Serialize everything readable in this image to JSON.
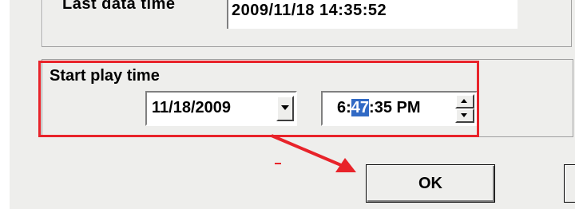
{
  "last_data": {
    "label": "Last data time",
    "value": "2009/11/18 14:35:52"
  },
  "start_play": {
    "label": "Start play time",
    "date": "11/18/2009",
    "time_hour": "6:",
    "time_minute": "47",
    "time_rest": ":35 PM"
  },
  "buttons": {
    "ok_label": "OK"
  },
  "colors": {
    "highlight_box": "#e8232a",
    "selection": "#316ac5",
    "dialog_bg": "#eeeeec"
  }
}
